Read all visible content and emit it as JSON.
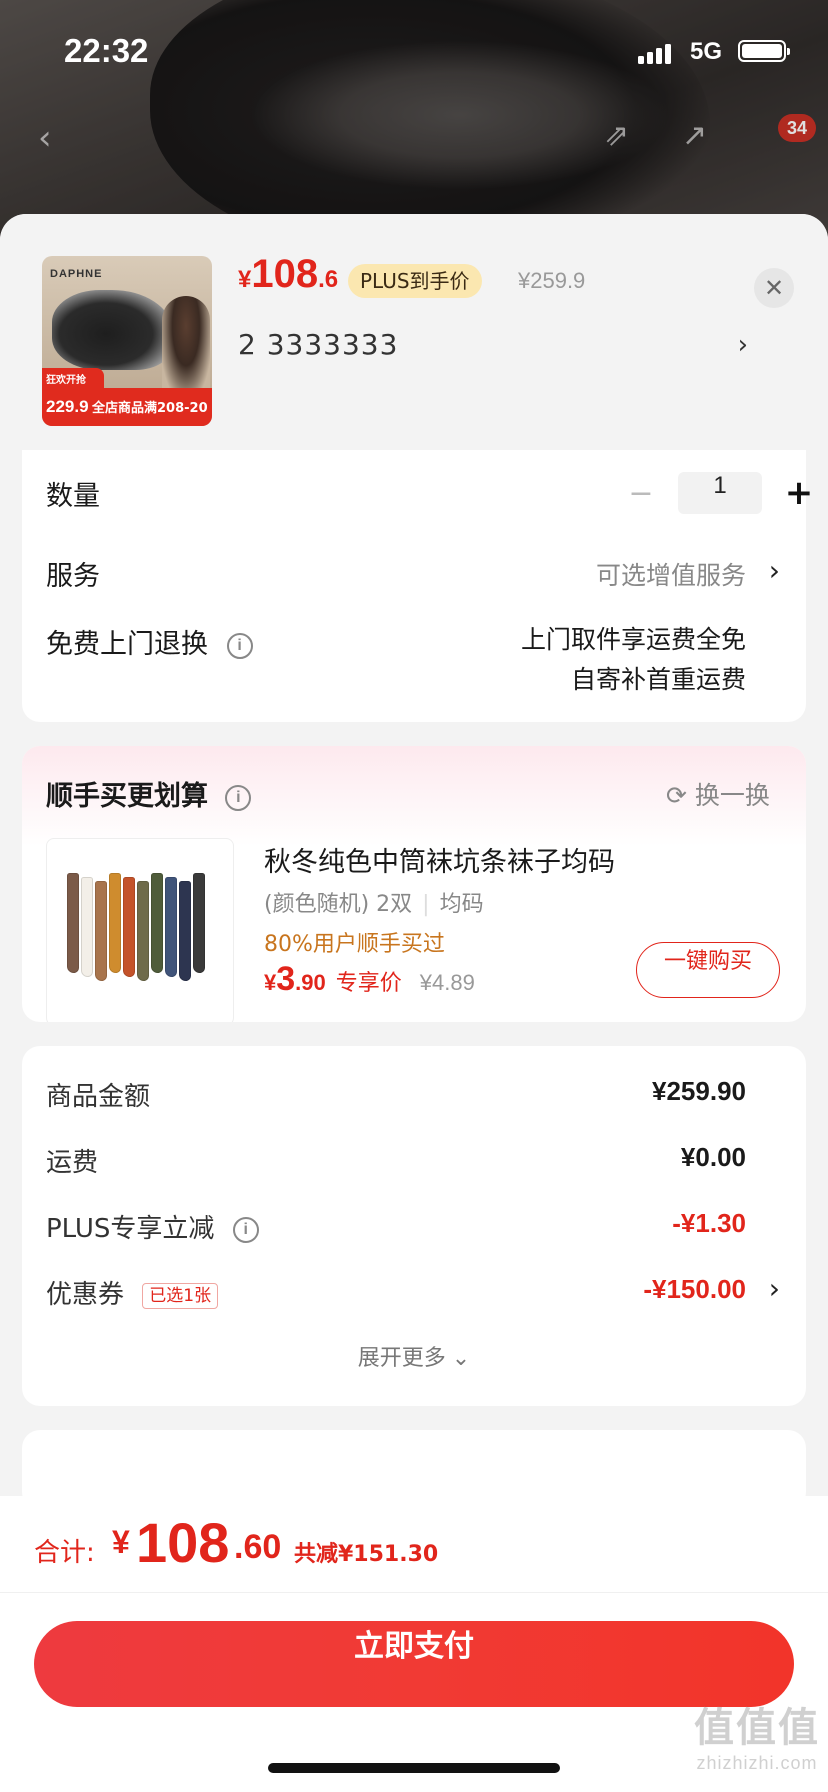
{
  "status_bar": {
    "time": "22:32",
    "network": "5G"
  },
  "background_nav": {
    "cart_count": "34"
  },
  "product": {
    "thumb_brand": "DAPHNE",
    "thumb_promo_top": "狂欢开抢",
    "thumb_promo_price": "229.9",
    "thumb_promo_text": "全店商品满208-20",
    "price_currency": "¥",
    "price_int": "108",
    "price_dec": ".6",
    "plus_label": "PLUS到手价",
    "original_price": "¥259.9",
    "spec_text": "2  3333333"
  },
  "options": {
    "quantity_label": "数量",
    "quantity_value": "1",
    "service_label": "服务",
    "service_value": "可选增值服务",
    "return_label": "免费上门退换",
    "return_line1": "上门取件享运费全免",
    "return_line2": "自寄补首重运费"
  },
  "addon": {
    "title": "顺手买更划算",
    "refresh_label": "换一换",
    "item_name": "秋冬纯色中筒袜坑条袜子均码",
    "item_spec": "(颜色随机) 2双",
    "item_size": "均码",
    "item_popularity": "80%用户顺手买过",
    "price_currency": "¥",
    "price_int": "3",
    "price_dec": ".90",
    "price_tag": "专享价",
    "price_original": "¥4.89",
    "buy_button": "一键购买",
    "sock_colors": [
      "#7b5a48",
      "#f3efe8",
      "#a8744c",
      "#cf8c2e",
      "#c4532a",
      "#6f6b4a",
      "#4f5c3a",
      "#40547a",
      "#2d3550",
      "#3a3a3a"
    ]
  },
  "summary": {
    "goods_label": "商品金额",
    "goods_value": "¥259.90",
    "shipping_label": "运费",
    "shipping_value": "¥0.00",
    "plus_label": "PLUS专享立减",
    "plus_value": "-¥1.30",
    "coupon_label": "优惠券",
    "coupon_badge": "已选1张",
    "coupon_value": "-¥150.00",
    "expand_label": "展开更多"
  },
  "total": {
    "label": "合计:",
    "currency": "¥",
    "int": "108",
    "dec": ".60",
    "saved": "共减¥151.30"
  },
  "pay_button": "立即支付",
  "watermark": {
    "logo": "值值值",
    "site": "zhizhizhi.com"
  },
  "colors": {
    "accent": "#e1251b",
    "plus_pill": "#fbe7b0",
    "addon_price": "#c8751e"
  }
}
